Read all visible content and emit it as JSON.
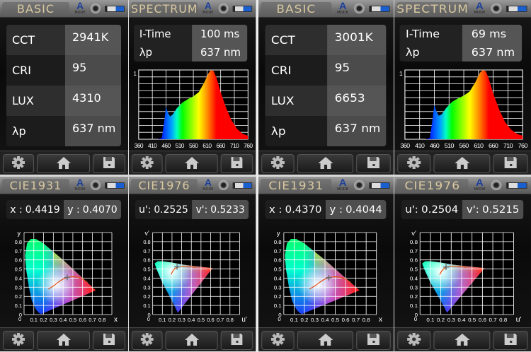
{
  "status_icons": {
    "mode_letter": "A",
    "mode_label": "MODE"
  },
  "screens": [
    {
      "type": "basic",
      "title": "BASIC",
      "rows": [
        {
          "label": "CCT",
          "value": "2941K"
        },
        {
          "label": "CRI",
          "value": "95"
        },
        {
          "label": "LUX",
          "value": "4310"
        },
        {
          "label": "λp",
          "value": "637 nm"
        }
      ]
    },
    {
      "type": "spectrum",
      "title": "SPECTRUM",
      "chart": 0,
      "rows": [
        {
          "label": "I-Time",
          "value": "100 ms"
        },
        {
          "label": "λp",
          "value": "637 nm"
        }
      ]
    },
    {
      "type": "basic",
      "title": "BASIC",
      "rows": [
        {
          "label": "CCT",
          "value": "3001K"
        },
        {
          "label": "CRI",
          "value": "95"
        },
        {
          "label": "LUX",
          "value": "6653"
        },
        {
          "label": "λp",
          "value": "637 nm"
        }
      ]
    },
    {
      "type": "spectrum",
      "title": "SPECTRUM",
      "chart": 1,
      "rows": [
        {
          "label": "I-Time",
          "value": "69 ms"
        },
        {
          "label": "λp",
          "value": "637 nm"
        }
      ]
    },
    {
      "type": "cie",
      "title": "CIE1931",
      "chart": 2,
      "a_label": "x :",
      "a_value": "0.4419",
      "b_label": "y :",
      "b_value": "0.4070"
    },
    {
      "type": "cie",
      "title": "CIE1976",
      "chart": 3,
      "a_label": "u':",
      "a_value": "0.2525",
      "b_label": "v':",
      "b_value": "0.5233"
    },
    {
      "type": "cie",
      "title": "CIE1931",
      "chart": 4,
      "a_label": "x :",
      "a_value": "0.4370",
      "b_label": "y :",
      "b_value": "0.4044"
    },
    {
      "type": "cie",
      "title": "CIE1976",
      "chart": 5,
      "a_label": "u':",
      "a_value": "0.2504",
      "b_label": "v':",
      "b_value": "0.5215"
    }
  ],
  "chart_data": [
    {
      "type": "area",
      "title": "Spectrum",
      "xlim": [
        360,
        760
      ],
      "ylim": [
        0,
        1
      ],
      "y_tick": "1",
      "xticks": [
        "360",
        "410",
        "460",
        "510",
        "560",
        "610",
        "660",
        "710",
        "760"
      ],
      "x": [
        380,
        430,
        445,
        455,
        460,
        465,
        475,
        485,
        500,
        520,
        540,
        560,
        580,
        600,
        615,
        625,
        635,
        645,
        660,
        680,
        700,
        720,
        740,
        760
      ],
      "y": [
        0,
        0,
        0.02,
        0.3,
        0.47,
        0.4,
        0.33,
        0.36,
        0.45,
        0.53,
        0.58,
        0.62,
        0.68,
        0.82,
        0.95,
        1.0,
        0.98,
        0.88,
        0.68,
        0.45,
        0.27,
        0.15,
        0.08,
        0.05
      ]
    },
    {
      "type": "area",
      "title": "Spectrum",
      "xlim": [
        360,
        760
      ],
      "ylim": [
        0,
        1
      ],
      "y_tick": "1",
      "xticks": [
        "360",
        "410",
        "460",
        "510",
        "560",
        "610",
        "660",
        "710",
        "760"
      ],
      "x": [
        380,
        430,
        445,
        455,
        460,
        465,
        475,
        485,
        500,
        520,
        540,
        560,
        580,
        600,
        615,
        625,
        635,
        645,
        660,
        680,
        700,
        720,
        740,
        760
      ],
      "y": [
        0,
        0,
        0.02,
        0.32,
        0.5,
        0.42,
        0.34,
        0.36,
        0.45,
        0.54,
        0.59,
        0.63,
        0.69,
        0.83,
        0.96,
        1.0,
        0.98,
        0.87,
        0.66,
        0.43,
        0.25,
        0.14,
        0.08,
        0.05
      ]
    },
    {
      "type": "scatter",
      "title": "CIE1931",
      "xlabel": "x",
      "ylabel": "y",
      "xlim": [
        0,
        0.9
      ],
      "ylim": [
        0,
        0.9
      ],
      "ticks": [
        "0",
        "0.1",
        "0.2",
        "0.3",
        "0.4",
        "0.5",
        "0.6",
        "0.7",
        "0.8"
      ],
      "point": [
        0.4419,
        0.407
      ]
    },
    {
      "type": "scatter",
      "title": "CIE1976",
      "xlabel": "u'",
      "ylabel": "v'",
      "xlim": [
        0,
        0.9
      ],
      "ylim": [
        0,
        0.9
      ],
      "ticks": [
        "0",
        "0.1",
        "0.2",
        "0.3",
        "0.4",
        "0.5",
        "0.6",
        "0.7",
        "0.8"
      ],
      "point": [
        0.2525,
        0.5233
      ]
    },
    {
      "type": "scatter",
      "title": "CIE1931",
      "xlabel": "x",
      "ylabel": "y",
      "xlim": [
        0,
        0.9
      ],
      "ylim": [
        0,
        0.9
      ],
      "ticks": [
        "0",
        "0.1",
        "0.2",
        "0.3",
        "0.4",
        "0.5",
        "0.6",
        "0.7",
        "0.8"
      ],
      "point": [
        0.437,
        0.4044
      ]
    },
    {
      "type": "scatter",
      "title": "CIE1976",
      "xlabel": "u'",
      "ylabel": "v'",
      "xlim": [
        0,
        0.9
      ],
      "ylim": [
        0,
        0.9
      ],
      "ticks": [
        "0",
        "0.1",
        "0.2",
        "0.3",
        "0.4",
        "0.5",
        "0.6",
        "0.7",
        "0.8"
      ],
      "point": [
        0.2504,
        0.5215
      ]
    }
  ]
}
